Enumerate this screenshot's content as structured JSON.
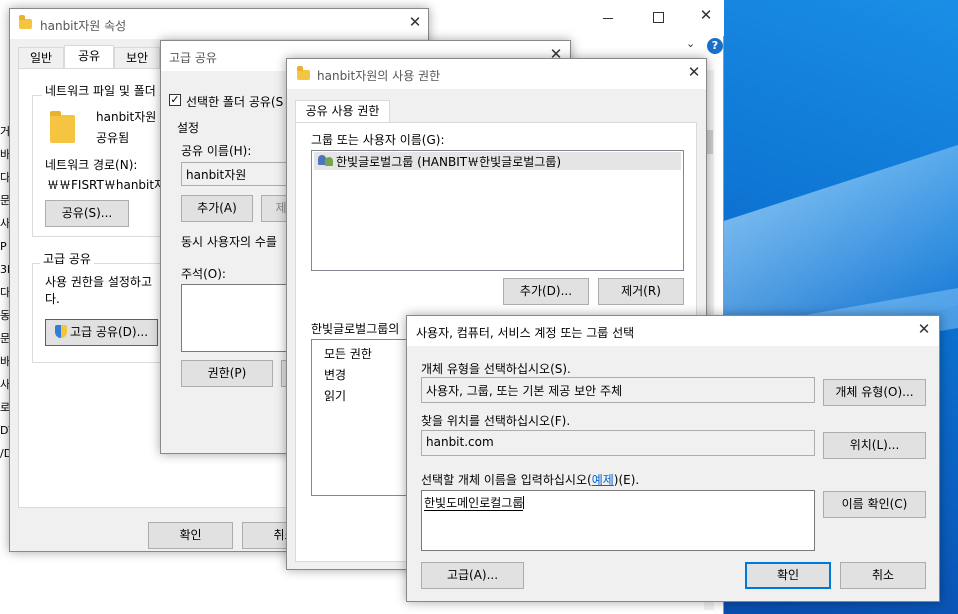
{
  "properties": {
    "title": "hanbit자원 속성",
    "tabs": [
      "일반",
      "공유",
      "보안"
    ],
    "network_group": "네트워크 파일 및 폴더",
    "folder_name": "hanbit자원",
    "folder_status": "공유됨",
    "network_path_label": "네트워크 경로(N):",
    "network_path_value": "￦￦FISRT￦hanbit자원",
    "share_button": "공유(S)...",
    "advanced_group": "고급 공유",
    "advanced_desc_line1": "사용 권한을 설정하고",
    "advanced_desc_line2": "다.",
    "advanced_button": "고급 공유(D)...",
    "ok": "확인",
    "cancel": "취소"
  },
  "explorer": {
    "left_items": [
      "거",
      "바",
      "다",
      "문",
      "사",
      "P",
      "3D",
      "다",
      "동",
      "문",
      "바",
      "사",
      "로",
      "DV",
      "/D"
    ]
  },
  "advanced": {
    "title": "고급 공유",
    "share_checkbox": "선택한 폴더 공유(S",
    "settings_label": "설정",
    "share_name_label": "공유 이름(H):",
    "share_name_value": "hanbit자원",
    "add_button": "추가(A)",
    "remove_button": "제",
    "users_limit_label": "동시 사용자의 수를",
    "comment_label": "주석(O):",
    "permissions_button": "권한(P)"
  },
  "perm": {
    "title": "hanbit자원의 사용 권한",
    "tab": "공유 사용 권한",
    "group_label": "그룹 또는 사용자 이름(G):",
    "users": [
      "한빛글로벌그룹 (HANBIT￦한빛글로벌그룹)"
    ],
    "add_button": "추가(D)...",
    "remove_button": "제거(R)",
    "perm_label": "한빛글로벌그룹의",
    "perm_items": [
      "모든 권한",
      "변경",
      "읽기"
    ]
  },
  "select": {
    "title": "사용자, 컴퓨터, 서비스 계정 또는 그룹 선택",
    "object_type_label": "개체 유형을 선택하십시오(S).",
    "object_type_value": "사용자, 그룹, 또는 기본 제공 보안 주체",
    "object_type_button": "개체 유형(O)...",
    "location_label": "찾을 위치를 선택하십시오(F).",
    "location_value": "hanbit.com",
    "location_button": "위치(L)...",
    "name_label_pre": "선택할 개체 이름을 입력하십시오(",
    "name_label_link": "예제",
    "name_label_post": ")(E).",
    "name_value": "한빛도메인로컬그룹",
    "check_button": "이름 확인(C)",
    "advanced_button": "고급(A)...",
    "ok": "확인",
    "cancel": "취소"
  }
}
